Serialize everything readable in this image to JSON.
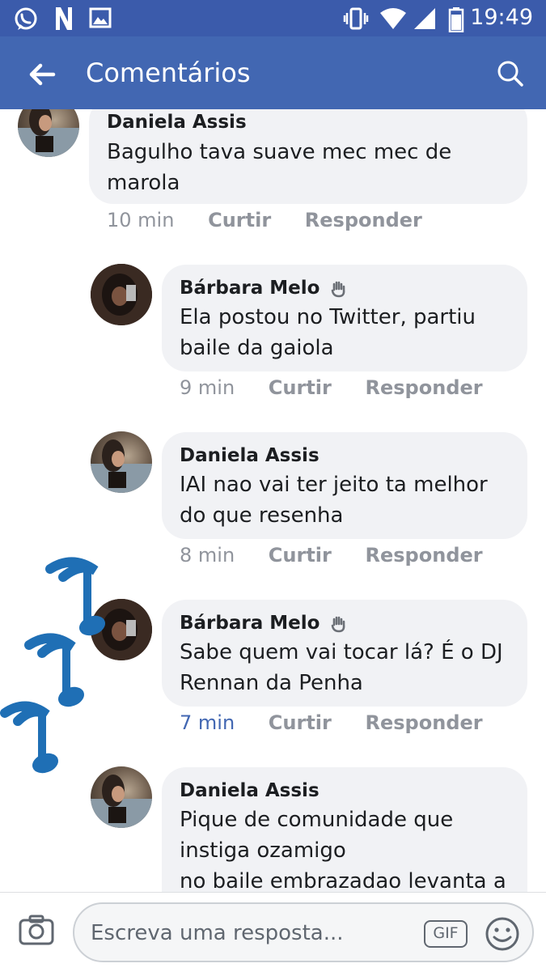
{
  "status_bar": {
    "time": "19:49",
    "left_icons": [
      "whatsapp-icon",
      "netflix-icon",
      "gallery-icon"
    ],
    "right_icons": [
      "vibrate-icon",
      "wifi-icon",
      "signal-icon",
      "battery-icon"
    ]
  },
  "app_bar": {
    "title": "Comentários",
    "back_icon": "arrow-left-icon",
    "search_icon": "search-icon"
  },
  "colors": {
    "status_bar": "#3b5bab",
    "app_bar": "#4267b2",
    "bubble": "#f1f2f5",
    "link_blue": "#4267b2",
    "meta_gray": "#90949c",
    "notes_blue": "#1f6fb5"
  },
  "comments": [
    {
      "author": "Daniela Assis",
      "text": "Bagulho tava suave mec mec de\nmarola",
      "time": "10 min",
      "like_label": "Curtir",
      "reply_label": "Responder"
    },
    {
      "author": "Bárbara Melo",
      "text": "Ela postou no Twitter, partiu\nbaile da gaiola",
      "time": "9 min",
      "like_label": "Curtir",
      "reply_label": "Responder"
    },
    {
      "author": "Daniela Assis",
      "text": "IAI nao vai ter jeito ta melhor\ndo que resenha",
      "time": "8 min",
      "like_label": "Curtir",
      "reply_label": "Responder"
    },
    {
      "author": "Bárbara Melo",
      "text": "Sabe quem vai tocar lá? É o DJ\nRennan da Penha",
      "time": "7 min",
      "like_label": "Curtir",
      "reply_label": "Responder"
    },
    {
      "author": "Daniela Assis",
      "text": "Pique de comunidade que\ninstiga ozamigo\nno baile embrazadao levanta a",
      "time": "",
      "like_label": "",
      "reply_label": ""
    }
  ],
  "composer": {
    "placeholder": "Escreva uma resposta...",
    "gif_label": "GIF",
    "camera_icon": "camera-icon",
    "emoji_icon": "smiley-icon"
  }
}
